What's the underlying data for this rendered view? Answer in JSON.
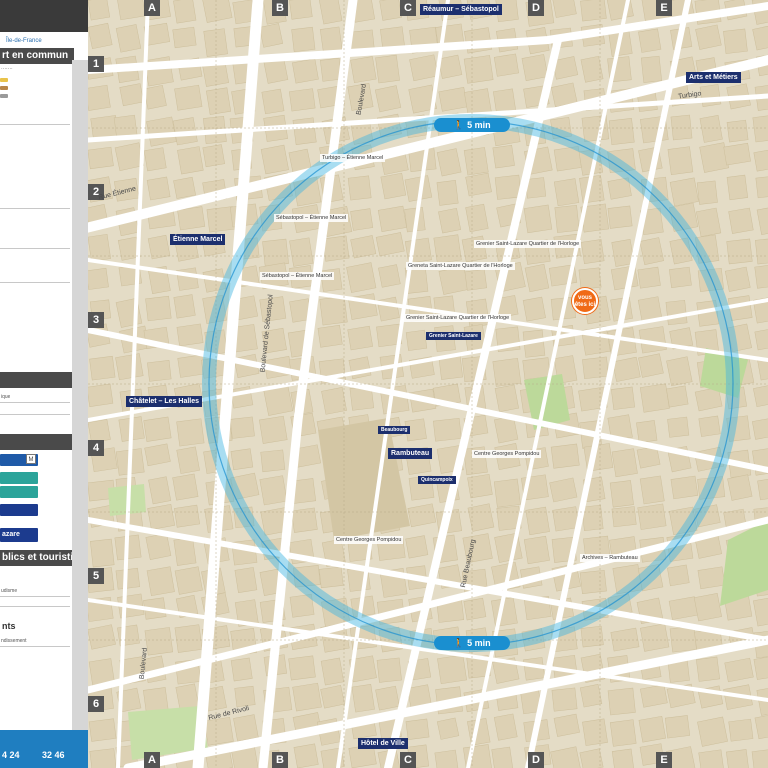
{
  "panel": {
    "logo_text": "Île-de-France",
    "section_transport": "rt en commun",
    "section_sites": "blics et touristiques",
    "section_events": "nts",
    "row_saint_lazare": "azare",
    "line_text_1": "udisme",
    "line_text_2": "ndissement",
    "footer_time_1": "4 24",
    "footer_time_2": "32 46"
  },
  "grid": {
    "columns": [
      "A",
      "B",
      "C",
      "D",
      "E"
    ],
    "rows": [
      "1",
      "2",
      "3",
      "4",
      "5",
      "6"
    ]
  },
  "map": {
    "walk_label": "5 min",
    "you_are_here": "vous êtes ici",
    "stations": [
      {
        "name": "Réaumur – Sébastopol"
      },
      {
        "name": "Arts et Métiers"
      },
      {
        "name": "Étienne Marcel"
      },
      {
        "name": "Châtelet – Les Halles"
      },
      {
        "name": "Rambuteau"
      },
      {
        "name": "Hôtel de Ville"
      }
    ],
    "stop_labels": [
      {
        "name": "Turbigo – Étienne Marcel"
      },
      {
        "name": "Sébastopol – Étienne Marcel"
      },
      {
        "name": "Sébastopol – Étienne Marcel"
      },
      {
        "name": "Greneta Saint-Lazare Quartier de l'Horloge"
      },
      {
        "name": "Grenier Saint-Lazare Quartier de l'Horloge"
      },
      {
        "name": "Grenier Saint-Lazare Quartier de l'Horloge"
      },
      {
        "name": "Centre Georges Pompidou"
      },
      {
        "name": "Centre Georges Pompidou"
      },
      {
        "name": "Archives – Rambuteau"
      },
      {
        "name": "Grenier Saint-Lazare"
      },
      {
        "name": "Beaubourg"
      },
      {
        "name": "Quincampoix"
      }
    ],
    "streets": {
      "turbigo": "Turbigo",
      "etienne": "Rue Étienne",
      "sebastopol": "Boulevard de Sébastopol",
      "rivoli": "Rue de Rivoli",
      "beaubourg": "Rue Beaubourg",
      "boulevard": "Boulevard"
    },
    "colors": {
      "walk_ring": "#3fb3e0",
      "station_badge": "#1c2f6e",
      "you_are_here": "#f06a16",
      "park": "#bcd99a",
      "block": "#ddd1b4",
      "street": "#ffffff"
    }
  }
}
